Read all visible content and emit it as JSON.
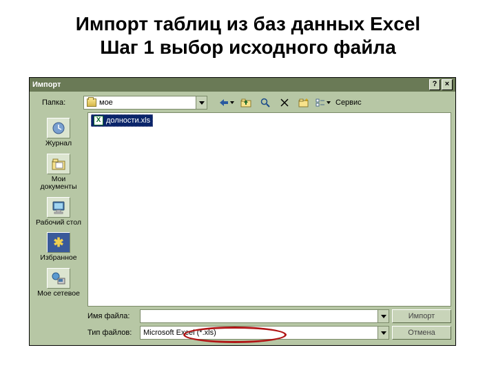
{
  "slide": {
    "title_line1": "Импорт таблиц из баз данных Excel",
    "title_line2": "Шаг 1 выбор исходного файла"
  },
  "dialog": {
    "title": "Импорт",
    "help_label": "?",
    "close_label": "×",
    "folder_label": "Папка:",
    "folder_value": "мое",
    "service_label": "Сервис",
    "selected_file": "долности.xls",
    "places": {
      "history": "Журнал",
      "my_documents": "Мои документы",
      "desktop": "Рабочий стол",
      "favorites": "Избранное",
      "network": "Мое сетевое"
    },
    "filename_label": "Имя файла:",
    "filename_value": "",
    "filetype_label": "Тип файлов:",
    "filetype_value": "Microsoft Excel (*.xls)",
    "import_button": "Импорт",
    "cancel_button": "Отмена"
  }
}
